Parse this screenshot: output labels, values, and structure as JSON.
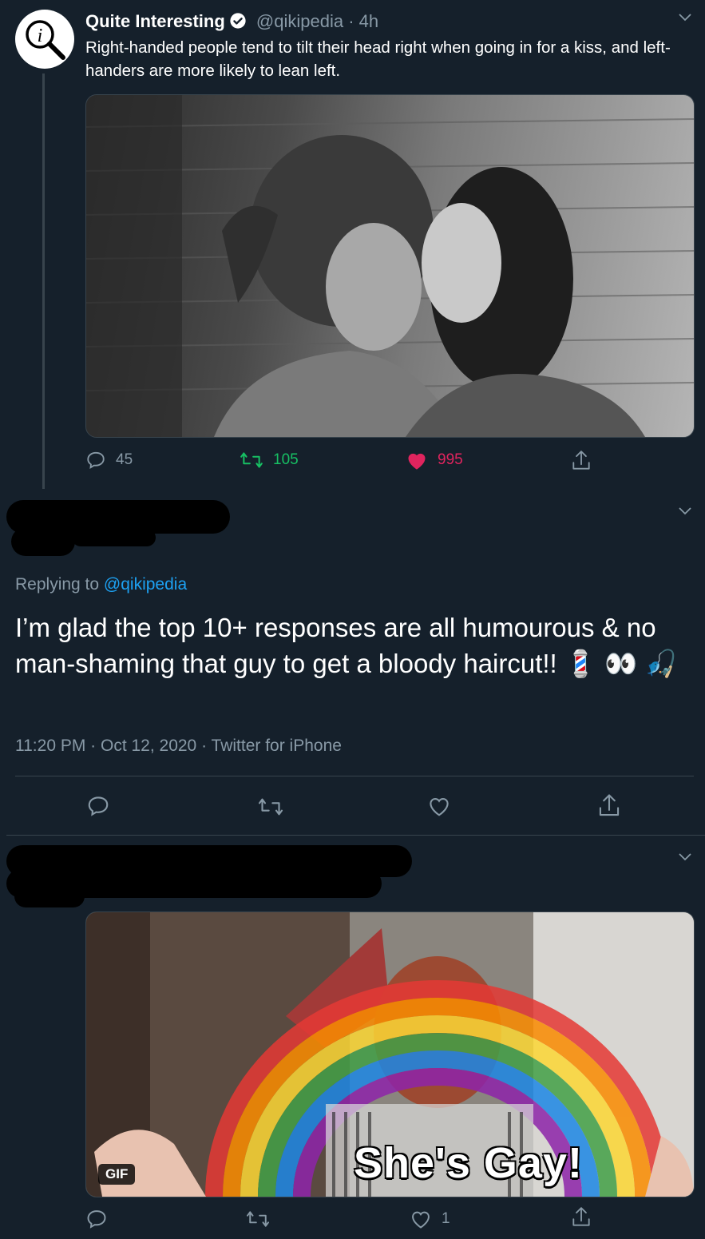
{
  "tweet1": {
    "author_name": "Quite Interesting",
    "author_handle": "@qikipedia",
    "time": "· 4h",
    "text": "Right-handed people tend to tilt their head right when going in for a kiss, and left-handers are more likely to lean left.",
    "replies": "45",
    "retweets": "105",
    "likes": "995"
  },
  "tweet2": {
    "replying_prefix": "Replying to",
    "replying_handle": "@qikipedia",
    "text": "I’m glad the top 10+ responses are all humourous & no man-shaming that guy to get a bloody haircut!! 💈 👀 🎣",
    "timestamp": "11:20 PM · Oct 12, 2020 · Twitter for iPhone"
  },
  "tweet3": {
    "gif_badge": "GIF",
    "gif_caption": "She's Gay!",
    "likes": "1"
  },
  "colors": {
    "background": "#15202b",
    "divider": "#38444d",
    "muted_text": "#8899a6",
    "link_blue": "#1da1f2",
    "retweet_green": "#17bf63",
    "like_pink": "#e0245e"
  },
  "icons": [
    "info-magnifier-icon",
    "verified-badge-icon",
    "chevron-down-icon",
    "reply-icon",
    "retweet-icon",
    "like-heart-icon",
    "share-icon"
  ]
}
